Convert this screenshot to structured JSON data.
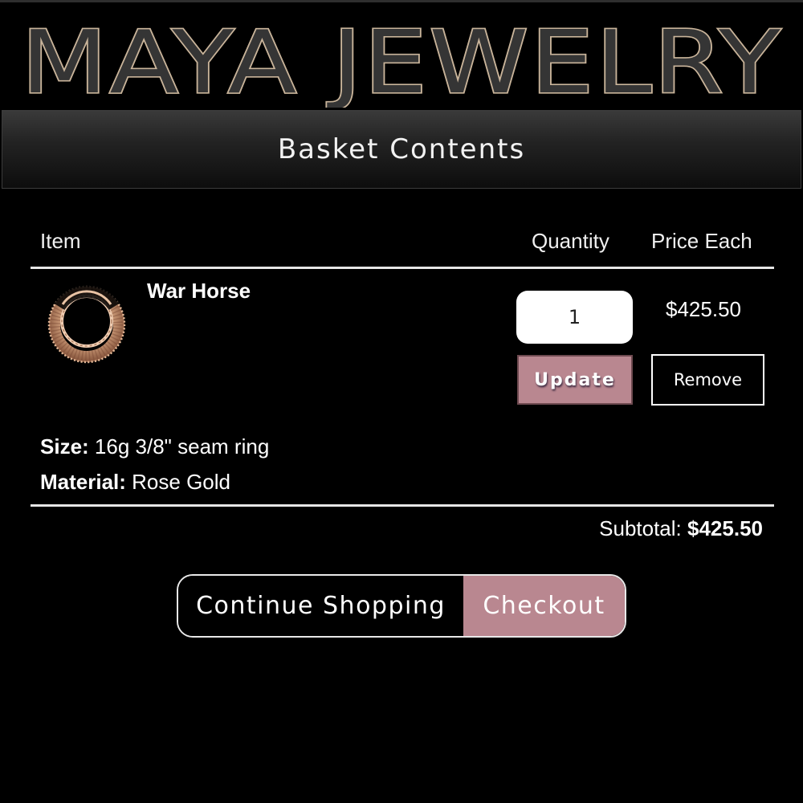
{
  "brand": {
    "logo_text": "MAYA JEWELRY",
    "accent_color": "#b98790",
    "logo_outline_color": "#c9b49a"
  },
  "page": {
    "title": "Basket Contents"
  },
  "table": {
    "headers": {
      "item": "Item",
      "quantity": "Quantity",
      "price_each": "Price Each"
    }
  },
  "cart": {
    "items": [
      {
        "name": "War Horse",
        "image_icon": "rose-gold-seam-ring",
        "quantity": "1",
        "price_each": "$425.50",
        "update_label": "Update",
        "remove_label": "Remove",
        "attributes": [
          {
            "label": "Size:",
            "value": "16g 3/8\" seam ring"
          },
          {
            "label": "Material:",
            "value": "Rose Gold"
          }
        ]
      }
    ],
    "subtotal_label": "Subtotal:",
    "subtotal_value": "$425.50"
  },
  "actions": {
    "continue_label": "Continue Shopping",
    "checkout_label": "Checkout"
  }
}
